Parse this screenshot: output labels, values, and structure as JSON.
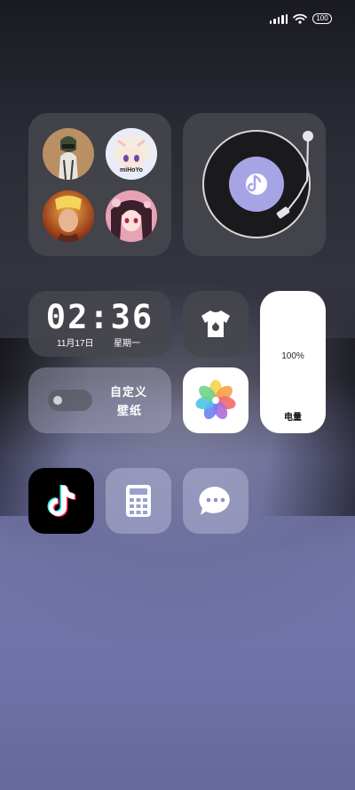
{
  "status_bar": {
    "battery_level": "100",
    "icons": [
      "signal-icon",
      "wifi-icon",
      "battery-icon"
    ]
  },
  "folder_games": {
    "apps": [
      {
        "name": "pubg-game-icon"
      },
      {
        "name": "genshin-game-icon",
        "overlay_text": "miHoYo"
      },
      {
        "name": "honor-of-kings-game-icon"
      },
      {
        "name": "anime-game-icon"
      }
    ]
  },
  "music_widget": {
    "icon": "music-note-icon"
  },
  "clock_widget": {
    "time": "02:36",
    "date": "11月17日",
    "weekday": "星期一"
  },
  "theme_widget": {
    "icon": "tshirt-icon"
  },
  "battery_widget": {
    "percent_text": "100%",
    "label": "电量",
    "level": 1.0
  },
  "wallpaper_widget": {
    "line1": "自定义",
    "line2": "壁纸"
  },
  "photos_app": {
    "icon": "photos-flower-icon"
  },
  "dock": {
    "apps": [
      {
        "icon": "tiktok-icon"
      },
      {
        "icon": "calculator-icon"
      },
      {
        "icon": "messages-icon"
      }
    ]
  },
  "colors": {
    "accent_purple": "#a7a4e6",
    "tiktok_bg": "#000000",
    "widget_dark": "#46464e"
  }
}
